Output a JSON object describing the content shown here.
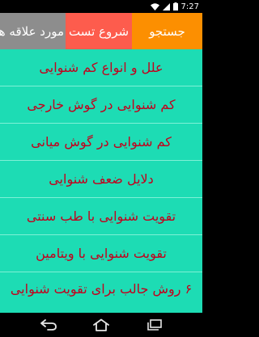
{
  "status_bar": {
    "time": "7:27",
    "icons": [
      "wifi-icon",
      "signal-icon",
      "battery-icon"
    ]
  },
  "tabs": [
    {
      "label": "مورد علاقه ها",
      "color": "#8d8d8d"
    },
    {
      "label": "شروع تست",
      "color": "#fd5c4d"
    },
    {
      "label": "جستجو",
      "color": "#fc8f01"
    }
  ],
  "list": {
    "background": "#1ddcb4",
    "text_color": "#c3001d",
    "items": [
      {
        "label": "علل و انواع کم شنوایی"
      },
      {
        "label": "کم شنوایی در گوش خارجی"
      },
      {
        "label": "کم شنوایی در گوش میانی"
      },
      {
        "label": "دلایل ضعف شنوایی"
      },
      {
        "label": "تقویت شنوایی با طب سنتی"
      },
      {
        "label": "تقویت شنوایی با ویتامین"
      },
      {
        "label": "۶ روش جالب برای تقویت شنوایی"
      }
    ]
  },
  "nav_bar": {
    "buttons": [
      "back-icon",
      "home-icon",
      "recent-apps-icon"
    ]
  }
}
